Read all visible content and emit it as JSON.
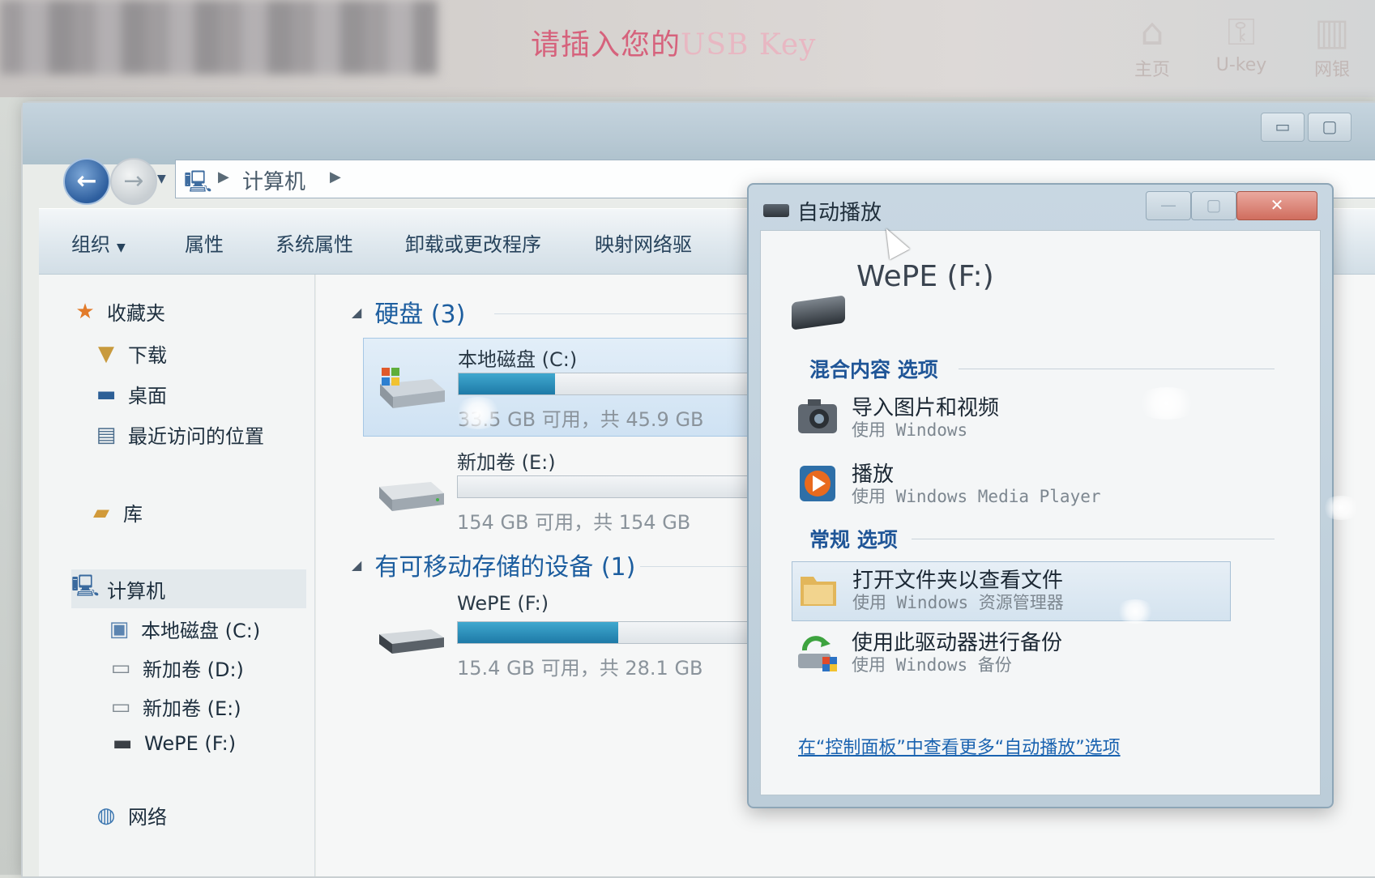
{
  "banner": {
    "prompt_lead": "请插入您的",
    "prompt_tail": "USB Key",
    "nav": [
      {
        "label": "主页",
        "icon": "home-icon"
      },
      {
        "label": "U-key",
        "icon": "usb-key-icon"
      },
      {
        "label": "网银",
        "icon": "bank-icon"
      }
    ]
  },
  "explorer": {
    "address": {
      "crumb": "计算机"
    },
    "toolbar": [
      "组织",
      "属性",
      "系统属性",
      "卸载或更改程序",
      "映射网络驱"
    ],
    "sidebar": {
      "favorites": "收藏夹",
      "fav_items": [
        "下载",
        "桌面",
        "最近访问的位置"
      ],
      "library": "库",
      "computer": "计算机",
      "computer_items": [
        "本地磁盘 (C:)",
        "新加卷 (D:)",
        "新加卷 (E:)",
        "WePE (F:)"
      ],
      "network": "网络"
    },
    "groups": {
      "hard_disks": "硬盘 (3)",
      "removable": "有可移动存储的设备 (1)"
    },
    "drives": [
      {
        "name": "本地磁盘 (C:)",
        "info": "33.5 GB 可用，共 45.9 GB",
        "used_fraction": 0.27
      },
      {
        "name": "新加卷 (E:)",
        "info": "154 GB 可用，共 154 GB",
        "used_fraction": 0.0
      },
      {
        "name": "WePE (F:)",
        "info": "15.4 GB 可用，共 28.1 GB",
        "used_fraction": 0.45
      }
    ]
  },
  "autoplay": {
    "title": "自动播放",
    "drive_name": "WePE (F:)",
    "mixed_section": "混合内容 选项",
    "general_section": "常规 选项",
    "options": [
      {
        "title": "导入图片和视频",
        "sub": "使用 Windows",
        "icon": "camera-icon"
      },
      {
        "title": "播放",
        "sub": "使用 Windows Media Player",
        "icon": "media-player-icon"
      },
      {
        "title": "打开文件夹以查看文件",
        "sub": "使用 Windows 资源管理器",
        "icon": "folder-icon"
      },
      {
        "title": "使用此驱动器进行备份",
        "sub": "使用 Windows 备份",
        "icon": "backup-icon"
      }
    ],
    "link": "在“控制面板”中查看更多“自动播放”选项"
  }
}
